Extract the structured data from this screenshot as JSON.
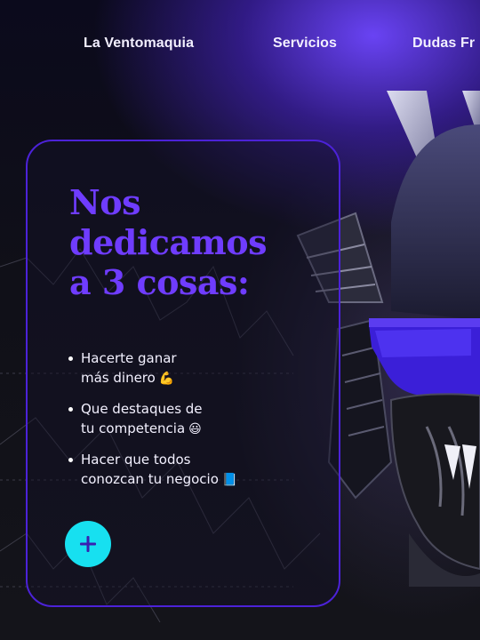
{
  "nav": {
    "items": [
      "La Ventomaquia",
      "Servicios",
      "Dudas Fr"
    ]
  },
  "hero": {
    "headline_lines": [
      "Nos",
      "dedicamos",
      "a 3 cosas:"
    ],
    "bullets": [
      {
        "line1": "Hacerte ganar",
        "line2": "más dinero",
        "emoji": "💪"
      },
      {
        "line1": "Que destaques de",
        "line2": "tu competencia",
        "emoji": "😃"
      },
      {
        "line1": "Hacer que todos",
        "line2": "conozcan tu negocio",
        "emoji": "📘"
      }
    ],
    "plus_icon": "plus-icon"
  },
  "colors": {
    "accent_purple": "#6f3cff",
    "card_border": "#4c22d8",
    "button_cyan": "#17e0f0"
  }
}
